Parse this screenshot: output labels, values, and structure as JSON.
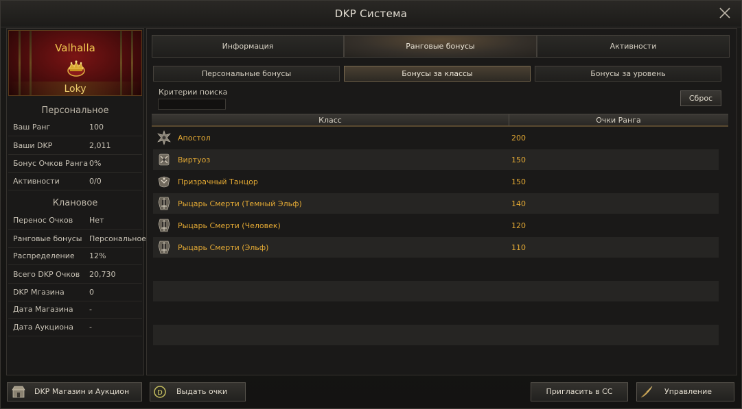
{
  "window": {
    "title": "DKP Система"
  },
  "profile": {
    "clan": "Valhalla",
    "player": "Loky"
  },
  "personal": {
    "title": "Персональное",
    "rows": [
      {
        "label": "Ваш Ранг",
        "value": "100"
      },
      {
        "label": "Ваши DKP",
        "value": "2,011"
      },
      {
        "label": "Бонус Очков Ранга",
        "value": "0%"
      },
      {
        "label": "Активности",
        "value": "0/0"
      }
    ]
  },
  "clan": {
    "title": "Клановое",
    "rows": [
      {
        "label": "Перенос Очков",
        "value": "Нет"
      },
      {
        "label": "Ранговые бонусы",
        "value": "Персональное"
      },
      {
        "label": "Распределение",
        "value": "12%"
      },
      {
        "label": "Всего DKP Очков",
        "value": "20,730"
      },
      {
        "label": "DKP Мгазина",
        "value": "0"
      },
      {
        "label": "Дата Магазина",
        "value": "-"
      },
      {
        "label": "Дата Аукциона",
        "value": "-"
      }
    ]
  },
  "tabs": [
    {
      "label": "Информация",
      "active": false
    },
    {
      "label": "Ранговые бонусы",
      "active": true
    },
    {
      "label": "Активности",
      "active": false
    }
  ],
  "subtabs": [
    {
      "label": "Персональные бонусы",
      "active": false
    },
    {
      "label": "Бонусы за классы",
      "active": true
    },
    {
      "label": "Бонусы за уровень",
      "active": false
    }
  ],
  "search": {
    "label": "Критерии поиска",
    "value": "",
    "reset_label": "Сброс"
  },
  "table": {
    "headers": [
      "Класс",
      "Очки Ранга"
    ],
    "rows": [
      {
        "class": "Апостол",
        "points": "200",
        "icon": "apostle-class-icon"
      },
      {
        "class": "Виртуоз",
        "points": "150",
        "icon": "virtuoso-class-icon"
      },
      {
        "class": "Призрачный Танцор",
        "points": "150",
        "icon": "phantom-dancer-class-icon"
      },
      {
        "class": "Рыцарь Смерти (Темный Эльф)",
        "points": "140",
        "icon": "death-knight-class-icon"
      },
      {
        "class": "Рыцарь Смерти (Человек)",
        "points": "120",
        "icon": "death-knight-class-icon"
      },
      {
        "class": "Рыцарь Смерти (Эльф)",
        "points": "110",
        "icon": "death-knight-class-icon"
      }
    ]
  },
  "buttons": {
    "shop": "DKP Магазин и Аукцион",
    "give_points": "Выдать очки",
    "invite_cc": "Пригласить в СС",
    "manage": "Управление"
  },
  "colors": {
    "accent": "#e3a934",
    "clan_name": "#f0c850",
    "banner_red": "#7a1414"
  }
}
